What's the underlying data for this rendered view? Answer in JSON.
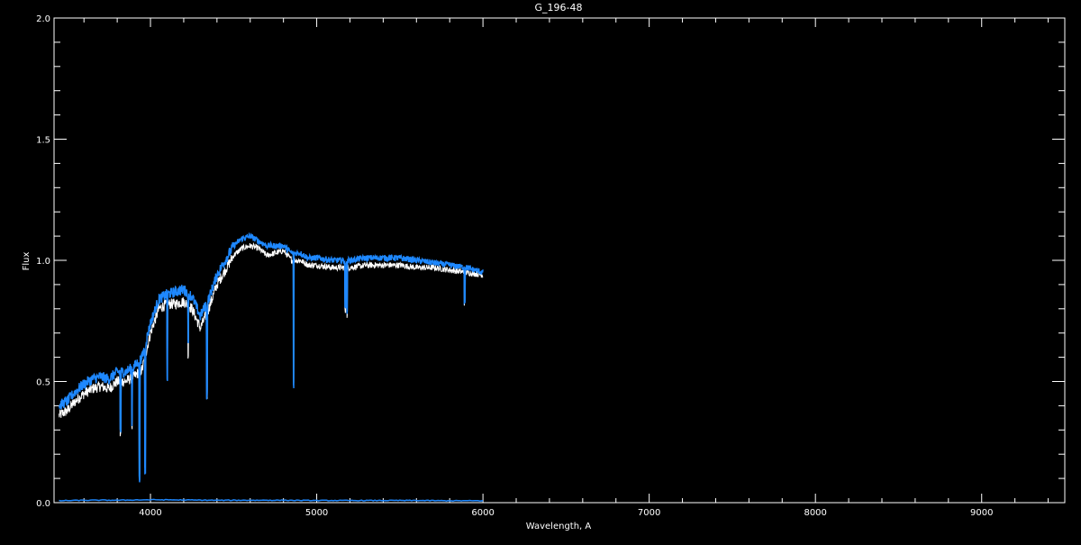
{
  "chart_data": {
    "type": "line",
    "title": "G_196-48",
    "xlabel": "Wavelength, A",
    "ylabel": "Flux",
    "xlim": [
      3420,
      9500
    ],
    "ylim": [
      0.0,
      2.0
    ],
    "x_ticks": [
      4000,
      5000,
      6000,
      7000,
      8000,
      9000
    ],
    "x_tick_labels": [
      "4000",
      "5000",
      "6000",
      "7000",
      "8000",
      "9000"
    ],
    "x_minor_step": 200,
    "y_ticks": [
      0.0,
      0.5,
      1.0,
      1.5,
      2.0
    ],
    "y_tick_labels": [
      "0.0",
      "0.5",
      "1.0",
      "1.5",
      "2.0"
    ],
    "y_minor_step": 0.1,
    "grid": false,
    "background": "#000000",
    "axis_color": "#ffffff",
    "series": [
      {
        "color": "#ffffff",
        "x": [
          3450,
          3500,
          3550,
          3600,
          3650,
          3700,
          3750,
          3800,
          3850,
          3900,
          3950,
          4000,
          4050,
          4100,
          4150,
          4200,
          4250,
          4300,
          4350,
          4400,
          4450,
          4500,
          4550,
          4600,
          4650,
          4700,
          4750,
          4800,
          4850,
          4900,
          4950,
          5000,
          5100,
          5200,
          5300,
          5400,
          5500,
          5600,
          5700,
          5800,
          5900,
          6000
        ],
        "y": [
          0.36,
          0.38,
          0.42,
          0.45,
          0.47,
          0.48,
          0.47,
          0.5,
          0.5,
          0.52,
          0.55,
          0.7,
          0.8,
          0.82,
          0.82,
          0.83,
          0.8,
          0.72,
          0.8,
          0.9,
          0.96,
          1.02,
          1.05,
          1.06,
          1.05,
          1.02,
          1.03,
          1.04,
          1.0,
          1.0,
          0.98,
          0.98,
          0.97,
          0.97,
          0.98,
          0.98,
          0.98,
          0.97,
          0.97,
          0.96,
          0.95,
          0.94
        ]
      },
      {
        "color": "#1e88ff",
        "x": [
          3450,
          3500,
          3550,
          3600,
          3650,
          3700,
          3750,
          3800,
          3850,
          3900,
          3950,
          4000,
          4050,
          4100,
          4150,
          4200,
          4250,
          4300,
          4350,
          4400,
          4450,
          4500,
          4550,
          4600,
          4650,
          4700,
          4750,
          4800,
          4850,
          4900,
          4950,
          5000,
          5100,
          5200,
          5300,
          5400,
          5500,
          5600,
          5700,
          5800,
          5900,
          6000
        ],
        "y": [
          0.4,
          0.42,
          0.46,
          0.49,
          0.51,
          0.52,
          0.51,
          0.54,
          0.54,
          0.56,
          0.6,
          0.74,
          0.84,
          0.86,
          0.87,
          0.88,
          0.85,
          0.77,
          0.84,
          0.94,
          1.0,
          1.06,
          1.09,
          1.1,
          1.08,
          1.06,
          1.06,
          1.06,
          1.03,
          1.03,
          1.01,
          1.01,
          1.0,
          1.0,
          1.01,
          1.01,
          1.01,
          1.0,
          0.99,
          0.98,
          0.97,
          0.95
        ]
      },
      {
        "color": "#1e88ff",
        "x": [
          3450,
          3600,
          3800,
          4000,
          4200,
          4400,
          4600,
          4800,
          5000,
          5200,
          5400,
          5600,
          5800,
          6000
        ],
        "y": [
          0.008,
          0.01,
          0.01,
          0.012,
          0.011,
          0.01,
          0.01,
          0.01,
          0.009,
          0.009,
          0.009,
          0.009,
          0.008,
          0.008
        ]
      }
    ],
    "absorption_lines": [
      {
        "x": 3820,
        "depth": 0.24
      },
      {
        "x": 3889,
        "depth": 0.22
      },
      {
        "x": 3934,
        "depth": 0.49
      },
      {
        "x": 3968,
        "depth": 0.52
      },
      {
        "x": 4101,
        "depth": 0.35
      },
      {
        "x": 4227,
        "depth": 0.22
      },
      {
        "x": 4340,
        "depth": 0.38
      },
      {
        "x": 4861,
        "depth": 0.55
      },
      {
        "x": 5172,
        "depth": 0.2
      },
      {
        "x": 5183,
        "depth": 0.22
      },
      {
        "x": 5890,
        "depth": 0.14
      }
    ]
  }
}
